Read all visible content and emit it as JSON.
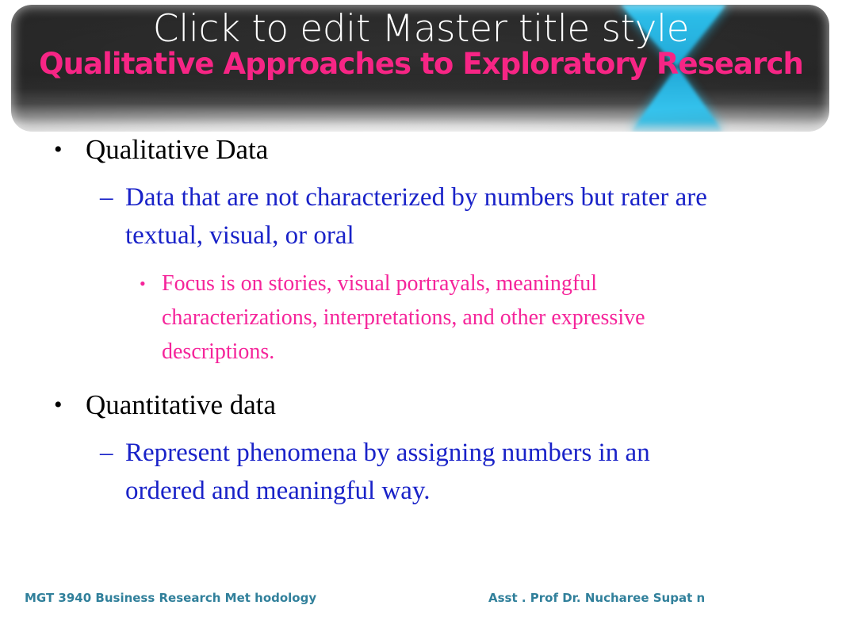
{
  "slide": {
    "master_title_placeholder": "Click to edit Master title style",
    "title": "Qualitative Approaches to Exploratory Research",
    "colors": {
      "title_pink": "#f72585",
      "banner_dark": "#262626",
      "accent_cyan": "#22b8e6",
      "level2_blue": "#1922c8",
      "level3_pink": "#f5249a",
      "footer_teal": "#31809b",
      "background": "#ffffff"
    },
    "decoration": {
      "bowtie_shape_name": "cyan-hourglass-accent"
    }
  },
  "body": {
    "bullets": [
      {
        "level": 1,
        "marker": "•",
        "text": "Qualitative Data"
      },
      {
        "level": 2,
        "marker": "–",
        "text": "Data that are not characterized by numbers but rater are textual, visual, or oral"
      },
      {
        "level": 3,
        "marker": "•",
        "text": "Focus is on stories, visual portrayals, meaningful characterizations, interpretations, and other expressive descriptions."
      },
      {
        "level": 1,
        "marker": "•",
        "text": "Quantitative data"
      },
      {
        "level": 2,
        "marker": "–",
        "text": "Represent phenomena by assigning numbers in an ordered and meaningful way."
      }
    ]
  },
  "footer": {
    "left": "MGT 3940 Business Research Met hodology",
    "right": "Asst . Prof Dr. Nucharee Supat n"
  }
}
